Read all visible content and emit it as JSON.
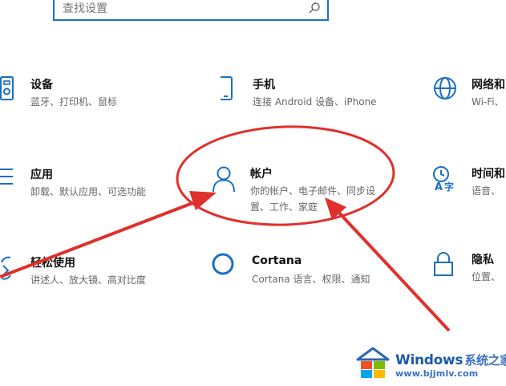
{
  "search": {
    "placeholder": "查找设置",
    "icon": "search-icon"
  },
  "tiles": [
    {
      "title": "设备",
      "desc": [
        "蓝牙、打印机、鼠标"
      ],
      "icon": "keyboard-devices-icon"
    },
    {
      "title": "手机",
      "desc": [
        "连接 Android 设备、iPhone"
      ],
      "icon": "phone-icon"
    },
    {
      "title": "网络和",
      "desc": [
        "Wi-Fi、"
      ],
      "icon": "globe-network-icon"
    },
    {
      "title": "应用",
      "desc": [
        "卸载、默认应用、可选功能"
      ],
      "icon": "apps-list-icon"
    },
    {
      "title": "帐户",
      "desc": [
        "你的帐户、电子邮件、同步设",
        "置、工作、家庭"
      ],
      "icon": "person-account-icon"
    },
    {
      "title": "时间和",
      "desc": [
        "语音、"
      ],
      "icon": "time-language-icon"
    },
    {
      "title": "轻松使用",
      "desc": [
        "讲述人、放大镜、高对比度"
      ],
      "icon": "ease-of-access-icon"
    },
    {
      "title": "Cortana",
      "desc": [
        "Cortana 语言、权限、通知"
      ],
      "icon": "cortana-circle-icon"
    },
    {
      "title": "隐私",
      "desc": [
        "位置、"
      ],
      "icon": "lock-privacy-icon"
    }
  ],
  "watermark": {
    "brand": "Windows",
    "brand_cn": "系统之家",
    "url": "www.bjjmlv.com"
  },
  "colors": {
    "accent": "#1a73c8",
    "icon_blue": "#1a6fc4",
    "annotation_red": "#e0302b"
  }
}
